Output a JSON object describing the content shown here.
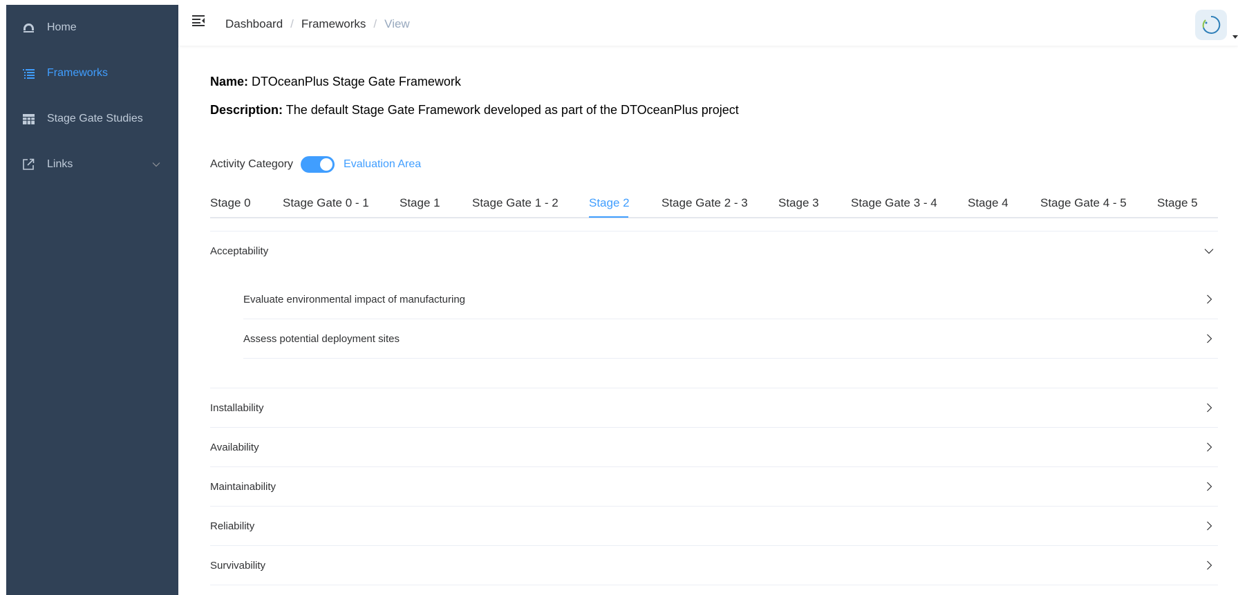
{
  "sidebar": {
    "items": [
      {
        "label": "Home",
        "icon": "dashboard-icon",
        "active": false
      },
      {
        "label": "Frameworks",
        "icon": "list-icon",
        "active": true
      },
      {
        "label": "Stage Gate Studies",
        "icon": "table-icon",
        "active": false
      },
      {
        "label": "Links",
        "icon": "external-link-icon",
        "active": false,
        "has_submenu": true
      }
    ]
  },
  "navbar": {
    "breadcrumb": [
      "Dashboard",
      "Frameworks",
      "View"
    ],
    "separator": "/"
  },
  "framework": {
    "name_label": "Name:",
    "name": "DTOceanPlus Stage Gate Framework",
    "description_label": "Description:",
    "description": "The default Stage Gate Framework developed as part of the DTOceanPlus project"
  },
  "toggle": {
    "left_label": "Activity Category",
    "right_label": "Evaluation Area",
    "state": "on"
  },
  "tabs": [
    "Stage 0",
    "Stage Gate 0 - 1",
    "Stage 1",
    "Stage Gate 1 - 2",
    "Stage 2",
    "Stage Gate 2 - 3",
    "Stage 3",
    "Stage Gate 3 - 4",
    "Stage 4",
    "Stage Gate 4 - 5",
    "Stage 5"
  ],
  "active_tab": "Stage 2",
  "areas": [
    {
      "title": "Acceptability",
      "expanded": true,
      "activities": [
        "Evaluate environmental impact of manufacturing",
        "Assess potential deployment sites"
      ]
    },
    {
      "title": "Installability",
      "expanded": false
    },
    {
      "title": "Availability",
      "expanded": false
    },
    {
      "title": "Maintainability",
      "expanded": false
    },
    {
      "title": "Reliability",
      "expanded": false
    },
    {
      "title": "Survivability",
      "expanded": false
    }
  ],
  "colors": {
    "sidebar_bg": "#304156",
    "sidebar_text": "#bfcbd9",
    "accent": "#409eff"
  }
}
